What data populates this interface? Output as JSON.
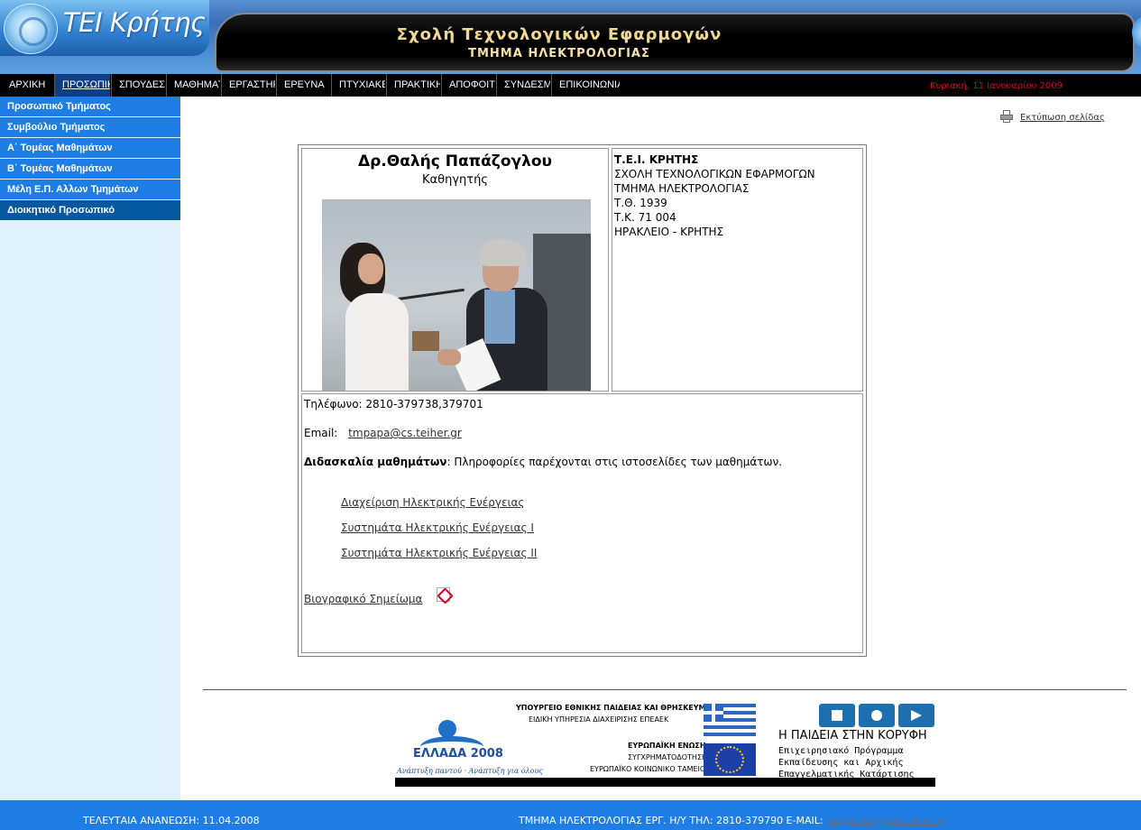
{
  "header": {
    "logo_text": "TEI Κρήτης",
    "title_line1": "Σχολή Τεχνολογικών Εφαρμογών",
    "title_line2": "ΤΜΗΜΑ ΗΛΕΚΤΡΟΛΟΓΙΑΣ"
  },
  "nav": {
    "items": [
      {
        "label": "ΑΡΧΙΚΗ",
        "active": false
      },
      {
        "label": "ΠΡΟΣΩΠΙΚΟ",
        "active": true
      },
      {
        "label": "ΣΠΟΥΔΕΣ",
        "active": false
      },
      {
        "label": "ΜΑΘΗΜΑΤΑ",
        "active": false
      },
      {
        "label": "ΕΡΓΑΣΤΗΡΙΑ",
        "active": false
      },
      {
        "label": "ΕΡΕΥΝΑ",
        "active": false
      },
      {
        "label": "ΠΤΥΧΙΑΚΕΣ",
        "active": false
      },
      {
        "label": "ΠΡΑΚΤΙΚΗ",
        "active": false
      },
      {
        "label": "ΑΠΟΦΟΙΤΟΙ",
        "active": false
      },
      {
        "label": "ΣΥΝΔΕΣΜΟΙ",
        "active": false
      },
      {
        "label": "ΕΠΙΚΟΙΝΩΝΙΑ",
        "active": false
      }
    ],
    "date": "Κυριακή, 11 Ιανουαρίου 2009"
  },
  "sidebar": {
    "items": [
      {
        "label": "Προσωπικό Τμήματος"
      },
      {
        "label": "Συμβούλιο Τμήματος"
      },
      {
        "label": "Α΄ Τομέας Μαθημάτων"
      },
      {
        "label": "Β΄ Τομέας Μαθημάτων"
      },
      {
        "label": "Μέλη Ε.Π. Αλλων Τμημάτων"
      },
      {
        "label": "Διοικητικό Προσωπικό"
      }
    ]
  },
  "print": {
    "label": "Εκτύπωση σελίδας",
    "icon": "printer-icon"
  },
  "profile": {
    "name": "Δρ.Θαλής Παπάζογλου",
    "role": "Καθηγητής",
    "address": {
      "line1": "Τ.Ε.Ι. ΚΡΗΤΗΣ",
      "line2": "ΣΧΟΛΗ ΤΕΧΝΟΛΟΓΙΚΩΝ ΕΦΑΡΜΟΓΩΝ",
      "line3": "ΤΜΗΜΑ ΗΛΕΚΤΡΟΛΟΓΙΑΣ",
      "line4": "Τ.Θ. 1939",
      "line5": "Τ.Κ. 71 004",
      "line6": "ΗΡΑΚΛΕΙΟ - ΚΡΗΤΗΣ"
    },
    "phone_label": "Τηλέφωνο:",
    "phone": "2810-379738,379701",
    "email_label": "Email:",
    "email": "tmpapa@cs.teiher.gr",
    "teaching_label": "Διδασκαλία μαθημάτων",
    "teaching_text": ": Πληροφορίες παρέχονται στις ιστοσελίδες των μαθημάτων.",
    "courses": [
      "Διαχείριση Ηλεκτρικής Ενέργειας",
      "Συστημάτα Ηλεκτρικής Ενέργειας I",
      "Συστημάτα Ηλεκτρικής Ενέργειας II"
    ],
    "cv_label": "Βιογραφικό Σημείωμα ",
    "cv_icon": "pdf-icon"
  },
  "sponsor": {
    "logo_text": "ΕΛΛΑΔΑ 2008",
    "tagline": "Ανάπτυξη παντού · Ανάπτυξη για όλους",
    "ministry": "ΥΠΟΥΡΓΕΙΟ ΕΘΝΙΚΗΣ ΠΑΙΔΕΙΑΣ ΚΑΙ ΘΡΗΣΚΕΥΜΑΤΩΝ",
    "agency": "ΕΙΔΙΚΗ ΥΠΗΡΕΣΙΑ ΔΙΑΧΕΙΡΙΣΗΣ ΕΠΕΑΕΚ",
    "eu1": "ΕΥΡΩΠΑΪΚΗ ΕΝΩΣΗ",
    "eu2": "ΣΥΓΧΡΗΜΑΤΟΔΟΤΗΣΗ",
    "eu3": "ΕΥΡΩΠΑΪΚΟ ΚΟΙΝΩΝΙΚΟ ΤΑΜΕΙΟ",
    "paideia_title": "Η ΠΑΙΔΕΙΑ ΣΤΗΝ ΚΟΡΥΦΗ",
    "paideia_l1": "Επιχειρησιακό Πρόγραμμα",
    "paideia_l2": "Εκπαίδευσης και Αρχικής",
    "paideia_l3": "Επαγγελματικής Κατάρτισης"
  },
  "footer": {
    "last_update": "ΤΕΛΕΥΤΑΙΑ ΑΝΑΝΕΩΣΗ: 11.04.2008",
    "contact": "ΤΜΗΜΑ ΗΛΕΚΤΡΟΛΟΓΙΑΣ ΕΡΓ. Η/Υ ΤΗΛ: 2810-379790 E-MAIL:",
    "email": "papathos@stef.teiher.gr"
  }
}
